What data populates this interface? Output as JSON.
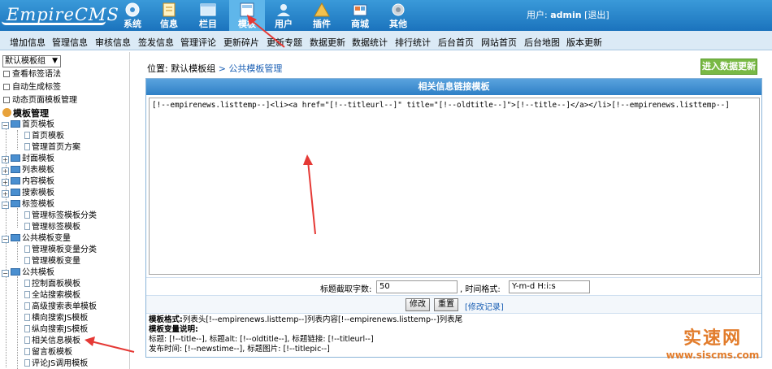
{
  "header": {
    "logo_text": "EmpireCMS",
    "nav": [
      {
        "label": "系统",
        "icon": "system-icon",
        "active": false
      },
      {
        "label": "信息",
        "icon": "info-icon",
        "active": false
      },
      {
        "label": "栏目",
        "icon": "column-icon",
        "active": false
      },
      {
        "label": "模板",
        "icon": "template-icon",
        "active": true
      },
      {
        "label": "用户",
        "icon": "user-icon",
        "active": false
      },
      {
        "label": "插件",
        "icon": "plugin-icon",
        "active": false
      },
      {
        "label": "商城",
        "icon": "shop-icon",
        "active": false
      },
      {
        "label": "其他",
        "icon": "other-icon",
        "active": false
      }
    ],
    "user_prefix": "用户:",
    "user_name": "admin",
    "logout": "[退出]"
  },
  "submenu": [
    "增加信息",
    "管理信息",
    "审核信息",
    "签发信息",
    "管理评论",
    "更新碎片",
    "更新专题",
    "数据更新",
    "数据统计",
    "排行统计",
    "后台首页",
    "网站首页",
    "后台地图",
    "版本更新"
  ],
  "sidebar": {
    "select_value": "默认模板组",
    "links": [
      "查看标签语法",
      "自动生成标签",
      "动态页面模板管理"
    ],
    "section_title": "模板管理",
    "tree": [
      {
        "label": "首页模板",
        "type": "folder-open"
      },
      {
        "label": "首页模板",
        "type": "doc"
      },
      {
        "label": "管理首页方案",
        "type": "doc"
      },
      {
        "label": "封面模板",
        "type": "folder"
      },
      {
        "label": "列表模板",
        "type": "folder"
      },
      {
        "label": "内容模板",
        "type": "folder"
      },
      {
        "label": "搜索模板",
        "type": "folder"
      },
      {
        "label": "标签模板",
        "type": "folder-open"
      },
      {
        "label": "管理标签模板分类",
        "type": "doc"
      },
      {
        "label": "管理标签模板",
        "type": "doc"
      },
      {
        "label": "公共模板变量",
        "type": "folder-open"
      },
      {
        "label": "管理模板变量分类",
        "type": "doc"
      },
      {
        "label": "管理模板变量",
        "type": "doc"
      },
      {
        "label": "公共模板",
        "type": "folder-open"
      },
      {
        "label": "控制面板模板",
        "type": "doc"
      },
      {
        "label": "全站搜索模板",
        "type": "doc"
      },
      {
        "label": "高级搜索表单模板",
        "type": "doc"
      },
      {
        "label": "横向搜索JS模板",
        "type": "doc"
      },
      {
        "label": "纵向搜索JS模板",
        "type": "doc"
      },
      {
        "label": "相关信息模板",
        "type": "doc"
      },
      {
        "label": "留言板模板",
        "type": "doc"
      },
      {
        "label": "评论JS调用模板",
        "type": "doc"
      }
    ]
  },
  "main": {
    "location_prefix": "位置:",
    "location_group": "默认模板组",
    "location_sep": " > ",
    "location_page": "公共模板管理",
    "import_button": "进入数据更新",
    "panel_title": "相关信息链接模板",
    "editor_value": "[!--empirenews.listtemp--]<li><a href=\"[!--titleurl--]\" title=\"[!--oldtitle--]\">[!--title--]</a></li>[!--empirenews.listtemp--]",
    "title_len_label": "标题截取字数:",
    "title_len_value": "50",
    "time_format_label": ", 时间格式:",
    "time_format_value": "Y-m-d H:i:s",
    "submit_button": "修改",
    "reset_button": "重置",
    "history_link": "[修改记录]",
    "help": {
      "format_label": "模板格式:",
      "format_text": "列表头[!--empirenews.listtemp--]列表内容[!--empirenews.listtemp--]列表尾",
      "vars_label": "模板变量说明:",
      "line1": "标题: [!--title--], 标题alt: [!--oldtitle--], 标题链接: [!--titleurl--]",
      "line2": "发布时间: [!--newstime--], 标题图片: [!--titlepic--]"
    }
  },
  "watermark": {
    "cn": "实速网",
    "url": "www.siscms.com"
  },
  "colors": {
    "topbar": "#1b73bd",
    "submenu": "#dbeaf6",
    "panel_title": "#2f80c6",
    "import_button": "#79b945",
    "arrow": "#e53935",
    "watermark": "#e27c2b"
  }
}
